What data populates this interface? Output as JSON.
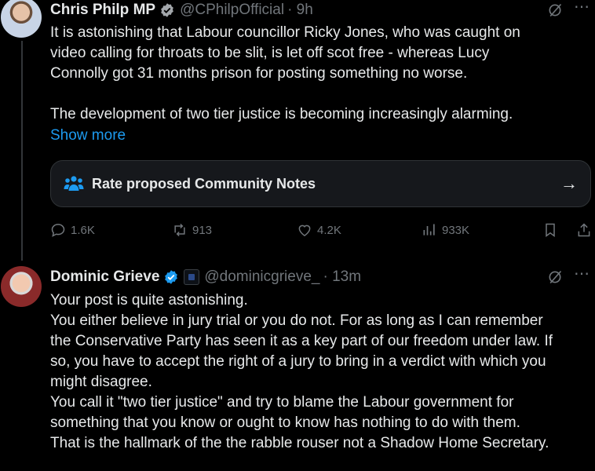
{
  "tweet1": {
    "author_name": "Chris Philp MP",
    "handle": "@CPhilpOfficial",
    "time": "· 9h",
    "text_p1": "It is astonishing that Labour councillor Ricky Jones, who was caught on\nvideo calling for throats to be slit, is let off scot free - whereas Lucy\nConnolly got 31 months prison for posting something no worse.",
    "text_p2": "The development of two tier justice is becoming increasingly alarming.",
    "show_more": "Show more",
    "community_notes_label": "Rate proposed Community Notes",
    "replies": "1.6K",
    "reposts": "913",
    "likes": "4.2K",
    "views": "933K"
  },
  "tweet2": {
    "author_name": "Dominic Grieve",
    "handle": "@dominicgrieve_",
    "time": "· 13m",
    "text": "Your post is quite astonishing.\nYou either believe in jury trial or you do not. For as long as I can remember\nthe Conservative Party has seen it as a key part of our freedom under law. If\nso, you have to accept the right of a jury to bring in a verdict with which you\nmight disagree.\nYou call it \"two tier justice\" and try to blame the Labour government for\nsomething that you know or ought to know has nothing to do with them.\nThat is the hallmark of the the rabble rouser not a Shadow Home Secretary."
  },
  "colors": {
    "background": "#000000",
    "text": "#e7e9ea",
    "muted": "#71767b",
    "accent": "#1d9bf0",
    "verified": "#1d9bf0"
  }
}
